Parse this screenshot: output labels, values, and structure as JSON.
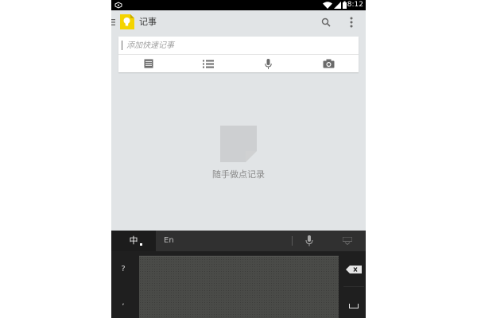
{
  "status_bar": {
    "time": "18:12",
    "icons": [
      "usb-debug-icon",
      "wifi-icon",
      "signal-icon",
      "battery-icon"
    ]
  },
  "app_bar": {
    "title": "记事",
    "icons": [
      "menu-drawer-icon",
      "keep-bulb-logo-icon",
      "search-icon",
      "overflow-menu-icon"
    ]
  },
  "quick_note": {
    "value": "",
    "placeholder": "添加快速记事",
    "tools": [
      "text-note-icon",
      "list-note-icon",
      "mic-icon",
      "camera-icon"
    ]
  },
  "empty_state": {
    "text": "随手做点记录",
    "icon": "empty-note-icon"
  },
  "keyboard": {
    "mode_chinese": "中",
    "mode_english": "En",
    "left_keys": [
      "?",
      ","
    ],
    "right_keys": [
      "backspace-icon",
      "space-icon"
    ],
    "toolbar_icons": [
      "mic-icon",
      "hide-keyboard-icon"
    ]
  },
  "colors": {
    "status_bar": "#000000",
    "app_background": "#e1e4e6",
    "keep_logo": "#f4d400",
    "keyboard_background": "#1f1f1f",
    "handwriting_pad": "#4a4b48"
  }
}
